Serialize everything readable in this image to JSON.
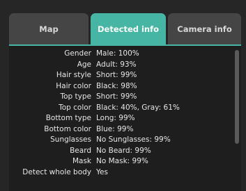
{
  "tabs": [
    {
      "label": "Map",
      "active": false
    },
    {
      "label": "Detected info",
      "active": true
    },
    {
      "label": "Camera info",
      "active": false
    }
  ],
  "colors": {
    "accent": "#46b5a3",
    "tab_inactive": "#454545",
    "background": "#262626",
    "content_bg": "#1e1e1e"
  },
  "details": [
    {
      "label": "Gender",
      "value": "Male: 100%"
    },
    {
      "label": "Age",
      "value": "Adult: 93%"
    },
    {
      "label": "Hair style",
      "value": "Short: 99%"
    },
    {
      "label": "Hair color",
      "value": "Black: 98%"
    },
    {
      "label": "Top type",
      "value": "Short: 99%"
    },
    {
      "label": "Top color",
      "value": "Black: 40%, Gray: 61%"
    },
    {
      "label": "Bottom type",
      "value": "Long: 99%"
    },
    {
      "label": "Bottom color",
      "value": "Blue: 99%"
    },
    {
      "label": "Sunglasses",
      "value": "No Sunglasses: 99%"
    },
    {
      "label": "Beard",
      "value": "No Beard: 99%"
    },
    {
      "label": "Mask",
      "value": "No Mask: 99%"
    },
    {
      "label": "Detect whole body",
      "value": "Yes"
    }
  ]
}
